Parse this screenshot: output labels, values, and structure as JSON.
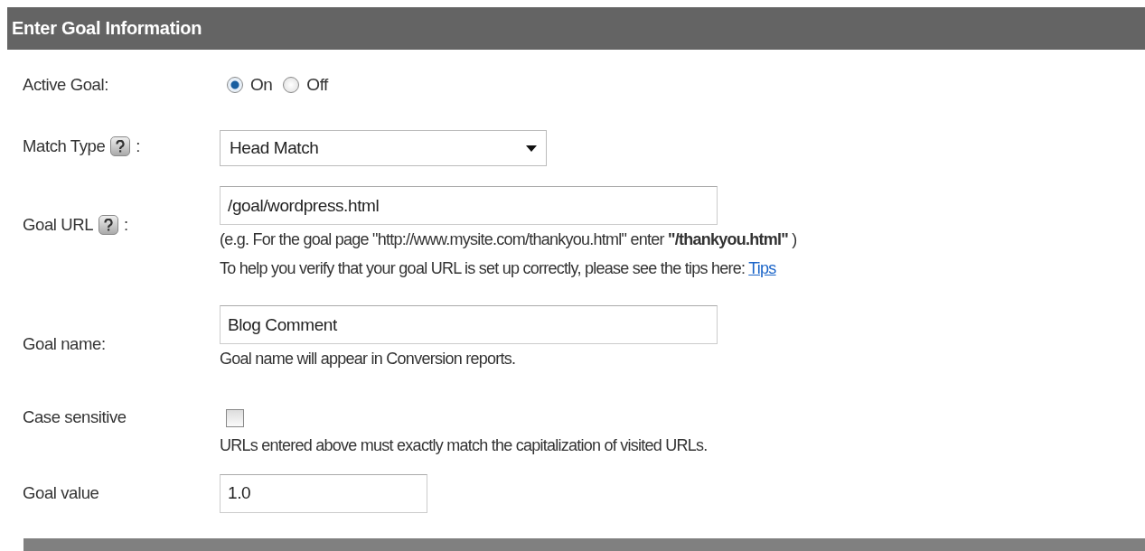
{
  "section": {
    "title": "Enter Goal Information"
  },
  "rows": [
    {
      "kind": "radio",
      "label": "Active Goal:",
      "options": [
        {
          "label": "On",
          "selected": true
        },
        {
          "label": "Off",
          "selected": false
        }
      ]
    },
    {
      "kind": "select",
      "label": "Match Type",
      "help": true,
      "separator": ":",
      "value": "Head Match"
    },
    {
      "kind": "text",
      "label": "Goal URL",
      "help": true,
      "separator": ":",
      "value": "/goal/wordpress.html",
      "wide": true,
      "notes": [
        {
          "text": "(e.g. For the goal page \"http://www.mysite.com/thankyou.html\" enter **\"/thankyou.html\"** )"
        },
        {
          "text": "To help you verify that your goal URL is set up correctly, please see the tips here:",
          "link": "Tips"
        }
      ]
    },
    {
      "kind": "text",
      "label": "Goal name:",
      "value": "Blog Comment",
      "wide": true,
      "notes": [
        {
          "text": "Goal name will appear in Conversion reports."
        }
      ]
    },
    {
      "kind": "checkbox",
      "label": "Case sensitive",
      "checked": false,
      "notes": [
        {
          "text": "URLs entered above must exactly match the capitalization of visited URLs."
        }
      ]
    },
    {
      "kind": "text",
      "label": "Goal value",
      "value": "1.0",
      "wide": false
    }
  ]
}
